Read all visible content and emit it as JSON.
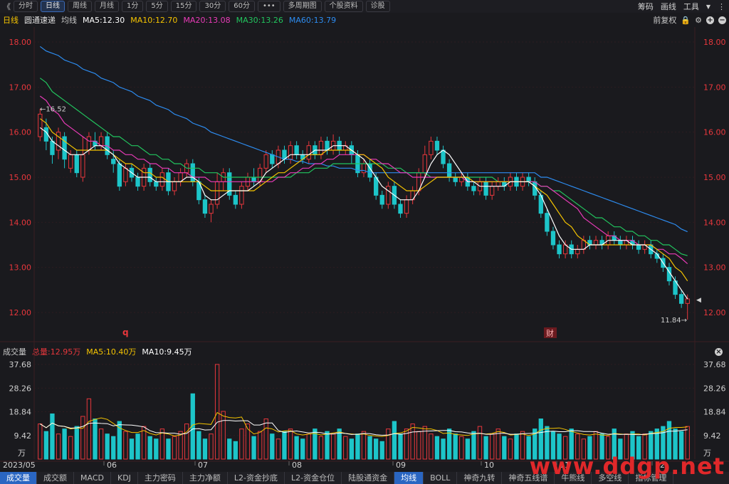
{
  "toolbar": {
    "back": "《",
    "tabs": [
      "分时",
      "日线",
      "周线",
      "月线",
      "1分",
      "5分",
      "15分",
      "30分",
      "60分",
      "•••",
      "多周期图",
      "个股资料",
      "诊股"
    ],
    "active_tab": "日线",
    "right": [
      "筹码",
      "画线",
      "工具"
    ]
  },
  "ma_bar": {
    "period": "日线",
    "name": "圆通速递",
    "label": "均线",
    "ma5": "MA5:12.30",
    "ma10": "MA10:12.70",
    "ma20": "MA20:13.08",
    "ma30": "MA30:13.26",
    "ma60": "MA60:13.79",
    "adjust": "前复权"
  },
  "colors": {
    "up": "#e8373c",
    "down": "#1dc5c9",
    "ma5": "#ffffff",
    "ma10": "#f5c400",
    "ma20": "#e93bb8",
    "ma30": "#22c55e",
    "ma60": "#2d8cf0",
    "axis_text": "#e8373c"
  },
  "price_axis": [
    "18.00",
    "17.00",
    "16.00",
    "15.00",
    "14.00",
    "13.00",
    "12.00"
  ],
  "price_annotations": {
    "high": "16.52",
    "low": "11.84"
  },
  "markers": {
    "q": "q",
    "cai": "财"
  },
  "volume_bar": {
    "title": "成交量",
    "total": "总量:12.95万",
    "ma5": "MA5:10.40万",
    "ma10": "MA10:9.45万"
  },
  "volume_axis": [
    "37.68",
    "28.26",
    "18.84",
    "9.42"
  ],
  "volume_unit": "万",
  "date_labels": [
    "2023/05",
    "06",
    "07",
    "08",
    "09",
    "10",
    "11",
    "12"
  ],
  "bottom_tabs": [
    "成交量",
    "成交额",
    "MACD",
    "KDJ",
    "主力密码",
    "主力净额",
    "L2-资金抄底",
    "L2-资金仓位",
    "陆股通资金",
    "均线",
    "BOLL",
    "神奇九转",
    "神奇五线谱",
    "牛熊线",
    "多空线",
    "指标管理"
  ],
  "active_bottom_tab": "成交量",
  "active_bottom_tab2": "均线",
  "watermark": "www.ddgp.net",
  "chart_data": {
    "type": "candlestick",
    "ylim": [
      11.6,
      18.2
    ],
    "candles": [
      [
        15.9,
        16.4,
        16.52,
        15.8
      ],
      [
        16.1,
        15.8,
        16.3,
        15.6
      ],
      [
        15.8,
        15.5,
        15.9,
        15.3
      ],
      [
        15.6,
        16.0,
        16.1,
        15.4
      ],
      [
        15.9,
        15.4,
        16.0,
        15.2
      ],
      [
        15.2,
        15.5,
        15.6,
        15.1
      ],
      [
        15.5,
        15.1,
        15.6,
        15.0
      ],
      [
        15.0,
        15.5,
        15.9,
        14.9
      ],
      [
        15.6,
        15.9,
        16.0,
        15.5
      ],
      [
        15.8,
        15.7,
        16.0,
        15.6
      ],
      [
        15.7,
        15.9,
        16.0,
        15.6
      ],
      [
        15.9,
        15.5,
        16.0,
        15.4
      ],
      [
        15.4,
        15.3,
        15.6,
        15.1
      ],
      [
        15.3,
        14.8,
        15.4,
        14.7
      ],
      [
        14.9,
        15.2,
        15.3,
        14.8
      ],
      [
        15.2,
        15.0,
        15.3,
        14.9
      ],
      [
        15.0,
        14.8,
        15.1,
        14.7
      ],
      [
        14.8,
        15.2,
        15.3,
        14.7
      ],
      [
        15.2,
        14.9,
        15.3,
        14.8
      ],
      [
        14.9,
        14.8,
        15.0,
        14.7
      ],
      [
        14.8,
        15.1,
        15.2,
        14.7
      ],
      [
        15.1,
        14.7,
        15.2,
        14.6
      ],
      [
        14.7,
        14.9,
        15.0,
        14.6
      ],
      [
        14.9,
        15.1,
        15.2,
        14.8
      ],
      [
        15.1,
        15.3,
        15.4,
        15.0
      ],
      [
        15.3,
        14.9,
        15.4,
        14.8
      ],
      [
        14.9,
        14.5,
        15.0,
        14.4
      ],
      [
        14.5,
        14.2,
        14.6,
        14.1
      ],
      [
        14.2,
        14.4,
        14.5,
        14.0
      ],
      [
        14.4,
        14.9,
        15.1,
        14.3
      ],
      [
        14.9,
        15.1,
        15.2,
        14.7
      ],
      [
        15.1,
        14.6,
        15.2,
        14.5
      ],
      [
        14.6,
        14.4,
        14.7,
        14.3
      ],
      [
        14.4,
        14.8,
        14.9,
        14.3
      ],
      [
        14.8,
        15.0,
        15.1,
        14.7
      ],
      [
        15.0,
        14.9,
        15.2,
        14.8
      ],
      [
        14.9,
        15.2,
        15.3,
        14.8
      ],
      [
        15.2,
        15.5,
        15.6,
        15.1
      ],
      [
        15.5,
        15.3,
        15.6,
        15.2
      ],
      [
        15.3,
        15.6,
        15.7,
        15.2
      ],
      [
        15.6,
        15.4,
        15.7,
        15.3
      ],
      [
        15.4,
        15.7,
        15.8,
        15.3
      ],
      [
        15.7,
        15.5,
        15.8,
        15.4
      ],
      [
        15.5,
        15.4,
        15.6,
        15.3
      ],
      [
        15.4,
        15.7,
        15.8,
        15.3
      ],
      [
        15.7,
        15.5,
        15.8,
        15.4
      ],
      [
        15.5,
        15.8,
        15.9,
        15.4
      ],
      [
        15.8,
        15.6,
        15.9,
        15.5
      ],
      [
        15.6,
        15.8,
        15.95,
        15.5
      ],
      [
        15.8,
        15.6,
        15.9,
        15.5
      ],
      [
        15.6,
        15.7,
        15.8,
        15.5
      ],
      [
        15.7,
        15.5,
        15.8,
        15.3
      ],
      [
        15.5,
        15.1,
        15.6,
        15.0
      ],
      [
        15.1,
        15.3,
        15.4,
        15.0
      ],
      [
        15.3,
        15.0,
        15.4,
        14.9
      ],
      [
        15.0,
        14.6,
        15.1,
        14.5
      ],
      [
        14.6,
        14.4,
        14.7,
        14.3
      ],
      [
        14.4,
        14.8,
        14.9,
        14.3
      ],
      [
        14.8,
        14.4,
        14.9,
        14.3
      ],
      [
        14.4,
        14.2,
        14.5,
        14.1
      ],
      [
        14.2,
        14.5,
        14.6,
        14.1
      ],
      [
        14.5,
        14.7,
        14.8,
        14.4
      ],
      [
        14.7,
        15.1,
        15.2,
        14.6
      ],
      [
        15.1,
        15.5,
        15.7,
        15.0
      ],
      [
        15.5,
        15.8,
        15.9,
        15.4
      ],
      [
        15.8,
        15.6,
        15.9,
        15.5
      ],
      [
        15.6,
        15.3,
        15.7,
        15.2
      ],
      [
        15.3,
        15.0,
        15.4,
        14.9
      ],
      [
        15.0,
        14.9,
        15.1,
        14.8
      ],
      [
        14.9,
        15.0,
        15.1,
        14.8
      ],
      [
        15.0,
        14.8,
        15.1,
        14.7
      ],
      [
        14.8,
        14.7,
        14.9,
        14.6
      ],
      [
        14.7,
        14.9,
        15.0,
        14.6
      ],
      [
        14.9,
        14.6,
        15.0,
        14.5
      ],
      [
        14.6,
        14.8,
        14.9,
        14.5
      ],
      [
        14.8,
        14.9,
        15.0,
        14.7
      ],
      [
        14.9,
        14.8,
        15.0,
        14.7
      ],
      [
        14.8,
        15.0,
        15.1,
        14.7
      ],
      [
        15.0,
        14.8,
        15.1,
        14.7
      ],
      [
        14.8,
        15.0,
        15.1,
        14.7
      ],
      [
        15.0,
        14.9,
        15.1,
        14.8
      ],
      [
        14.9,
        14.6,
        15.0,
        14.5
      ],
      [
        14.6,
        14.2,
        14.7,
        14.1
      ],
      [
        14.2,
        13.8,
        14.3,
        13.7
      ],
      [
        13.8,
        13.5,
        13.9,
        13.4
      ],
      [
        13.5,
        13.3,
        13.6,
        13.2
      ],
      [
        13.3,
        13.5,
        13.6,
        13.2
      ],
      [
        13.5,
        13.3,
        13.6,
        13.2
      ],
      [
        13.3,
        13.4,
        13.5,
        13.2
      ],
      [
        13.4,
        13.6,
        13.7,
        13.3
      ],
      [
        13.6,
        13.5,
        13.7,
        13.4
      ],
      [
        13.5,
        13.6,
        13.7,
        13.4
      ],
      [
        13.6,
        13.5,
        13.7,
        13.4
      ],
      [
        13.5,
        13.7,
        13.8,
        13.4
      ],
      [
        13.7,
        13.6,
        13.8,
        13.5
      ],
      [
        13.6,
        13.5,
        13.7,
        13.4
      ],
      [
        13.5,
        13.6,
        13.7,
        13.4
      ],
      [
        13.6,
        13.5,
        13.7,
        13.4
      ],
      [
        13.5,
        13.4,
        13.6,
        13.3
      ],
      [
        13.4,
        13.5,
        13.6,
        13.3
      ],
      [
        13.5,
        13.3,
        13.6,
        13.2
      ],
      [
        13.3,
        13.2,
        13.4,
        13.1
      ],
      [
        13.2,
        13.0,
        13.3,
        12.9
      ],
      [
        13.0,
        12.7,
        13.1,
        12.6
      ],
      [
        12.7,
        12.4,
        12.8,
        12.3
      ],
      [
        12.4,
        12.2,
        12.5,
        12.1
      ],
      [
        12.2,
        12.3,
        12.4,
        11.84
      ]
    ],
    "volume_ylim": [
      0,
      37.68
    ],
    "volumes": [
      14,
      11,
      18,
      10,
      12,
      9,
      13,
      17,
      24,
      16,
      12,
      10,
      9,
      15,
      11,
      8,
      10,
      13,
      9,
      8,
      12,
      8,
      9,
      11,
      14,
      26,
      11,
      8,
      10,
      37.68,
      19,
      8,
      7,
      12,
      14,
      9,
      11,
      16,
      10,
      8,
      11,
      12,
      9,
      8,
      10,
      12,
      9,
      11,
      10,
      12,
      9,
      8,
      10,
      11,
      9,
      8,
      7,
      12,
      15,
      10,
      12,
      14,
      11,
      13,
      10,
      9,
      8,
      12,
      10,
      9,
      8,
      11,
      13,
      9,
      10,
      12,
      9,
      8,
      10,
      11,
      9,
      12,
      16,
      13,
      11,
      10,
      9,
      12,
      10,
      8,
      9,
      11,
      10,
      9,
      12,
      8,
      10,
      11,
      9,
      10,
      11,
      12,
      13,
      15,
      12,
      11,
      13
    ],
    "ma5": [
      16.1,
      16.0,
      15.8,
      15.7,
      15.6,
      15.5,
      15.5,
      15.5,
      15.6,
      15.7,
      15.7,
      15.6,
      15.5,
      15.3,
      15.2,
      15.1,
      15.0,
      15.0,
      15.0,
      14.9,
      14.9,
      14.9,
      14.9,
      14.9,
      15.0,
      15.0,
      14.9,
      14.6,
      14.5,
      14.5,
      14.6,
      14.7,
      14.7,
      14.7,
      14.7,
      14.8,
      14.9,
      15.1,
      15.2,
      15.3,
      15.4,
      15.5,
      15.5,
      15.5,
      15.5,
      15.6,
      15.6,
      15.6,
      15.7,
      15.7,
      15.7,
      15.6,
      15.5,
      15.4,
      15.2,
      15.0,
      14.8,
      14.7,
      14.6,
      14.5,
      14.5,
      14.5,
      14.7,
      15.0,
      15.3,
      15.5,
      15.6,
      15.5,
      15.3,
      15.1,
      14.9,
      14.9,
      14.8,
      14.8,
      14.8,
      14.8,
      14.8,
      14.9,
      14.9,
      14.9,
      14.9,
      14.8,
      14.6,
      14.3,
      14.0,
      13.7,
      13.5,
      13.4,
      13.4,
      13.4,
      13.5,
      13.5,
      13.5,
      13.6,
      13.6,
      13.6,
      13.6,
      13.5,
      13.5,
      13.5,
      13.4,
      13.3,
      13.1,
      12.9,
      12.7,
      12.5,
      12.3
    ],
    "ma10": [
      16.3,
      16.2,
      16.0,
      15.9,
      15.8,
      15.7,
      15.6,
      15.6,
      15.6,
      15.6,
      15.6,
      15.6,
      15.5,
      15.4,
      15.3,
      15.3,
      15.2,
      15.1,
      15.1,
      15.0,
      15.0,
      14.9,
      14.9,
      14.9,
      14.9,
      14.9,
      14.9,
      14.8,
      14.7,
      14.7,
      14.7,
      14.7,
      14.7,
      14.7,
      14.7,
      14.7,
      14.8,
      14.9,
      15.0,
      15.1,
      15.1,
      15.2,
      15.3,
      15.4,
      15.5,
      15.5,
      15.5,
      15.6,
      15.6,
      15.6,
      15.6,
      15.6,
      15.5,
      15.5,
      15.4,
      15.3,
      15.2,
      15.0,
      14.9,
      14.8,
      14.7,
      14.7,
      14.7,
      14.8,
      14.9,
      15.0,
      15.0,
      15.0,
      15.0,
      15.0,
      15.0,
      14.9,
      14.9,
      14.9,
      14.9,
      14.9,
      14.9,
      14.9,
      14.9,
      14.9,
      14.9,
      14.8,
      14.7,
      14.6,
      14.4,
      14.2,
      14.0,
      13.9,
      13.7,
      13.6,
      13.5,
      13.5,
      13.5,
      13.5,
      13.5,
      13.5,
      13.5,
      13.5,
      13.5,
      13.5,
      13.5,
      13.4,
      13.3,
      13.2,
      13.0,
      12.9,
      12.7
    ],
    "ma20": [
      16.8,
      16.7,
      16.5,
      16.4,
      16.2,
      16.1,
      16.0,
      15.9,
      15.8,
      15.8,
      15.7,
      15.7,
      15.6,
      15.6,
      15.5,
      15.5,
      15.4,
      15.4,
      15.3,
      15.3,
      15.2,
      15.2,
      15.1,
      15.1,
      15.1,
      15.0,
      15.0,
      15.0,
      14.9,
      14.9,
      14.9,
      14.9,
      14.9,
      14.9,
      14.9,
      14.9,
      14.9,
      14.9,
      14.9,
      15.0,
      15.0,
      15.1,
      15.1,
      15.2,
      15.2,
      15.3,
      15.3,
      15.4,
      15.4,
      15.5,
      15.5,
      15.5,
      15.5,
      15.5,
      15.4,
      15.4,
      15.3,
      15.3,
      15.2,
      15.1,
      15.1,
      15.0,
      15.0,
      15.0,
      15.0,
      15.0,
      15.0,
      15.0,
      15.0,
      15.0,
      14.9,
      14.9,
      14.9,
      14.9,
      14.9,
      14.9,
      14.9,
      14.9,
      14.9,
      14.9,
      14.9,
      14.9,
      14.8,
      14.8,
      14.7,
      14.6,
      14.5,
      14.4,
      14.3,
      14.1,
      14.0,
      13.9,
      13.8,
      13.7,
      13.7,
      13.6,
      13.6,
      13.6,
      13.5,
      13.5,
      13.5,
      13.4,
      13.4,
      13.3,
      13.3,
      13.2,
      13.08
    ],
    "ma30": [
      17.2,
      17.1,
      16.9,
      16.8,
      16.7,
      16.6,
      16.5,
      16.4,
      16.3,
      16.2,
      16.1,
      16.0,
      15.9,
      15.9,
      15.8,
      15.7,
      15.7,
      15.6,
      15.5,
      15.5,
      15.4,
      15.4,
      15.3,
      15.3,
      15.2,
      15.2,
      15.2,
      15.1,
      15.1,
      15.1,
      15.0,
      15.0,
      15.0,
      15.0,
      15.0,
      15.0,
      15.0,
      15.0,
      15.0,
      15.0,
      15.0,
      15.0,
      15.1,
      15.1,
      15.1,
      15.2,
      15.2,
      15.2,
      15.3,
      15.3,
      15.3,
      15.3,
      15.3,
      15.3,
      15.3,
      15.3,
      15.3,
      15.2,
      15.2,
      15.2,
      15.1,
      15.1,
      15.1,
      15.1,
      15.0,
      15.0,
      15.0,
      15.0,
      15.0,
      15.0,
      15.0,
      15.0,
      15.0,
      15.0,
      15.0,
      14.9,
      14.9,
      14.9,
      14.9,
      14.9,
      14.9,
      14.9,
      14.8,
      14.8,
      14.7,
      14.7,
      14.6,
      14.5,
      14.4,
      14.3,
      14.2,
      14.1,
      14.1,
      14.0,
      13.9,
      13.9,
      13.8,
      13.8,
      13.7,
      13.7,
      13.6,
      13.6,
      13.5,
      13.5,
      13.4,
      13.3,
      13.26
    ],
    "ma60": [
      17.9,
      17.8,
      17.75,
      17.7,
      17.6,
      17.55,
      17.5,
      17.4,
      17.35,
      17.3,
      17.2,
      17.15,
      17.1,
      17.0,
      16.95,
      16.9,
      16.8,
      16.75,
      16.7,
      16.6,
      16.55,
      16.5,
      16.4,
      16.35,
      16.3,
      16.2,
      16.15,
      16.1,
      16.0,
      15.95,
      15.9,
      15.85,
      15.8,
      15.75,
      15.7,
      15.65,
      15.6,
      15.55,
      15.5,
      15.45,
      15.4,
      15.4,
      15.35,
      15.35,
      15.3,
      15.3,
      15.3,
      15.25,
      15.25,
      15.2,
      15.2,
      15.2,
      15.15,
      15.15,
      15.1,
      15.1,
      15.1,
      15.1,
      15.1,
      15.1,
      15.1,
      15.1,
      15.1,
      15.1,
      15.1,
      15.1,
      15.1,
      15.1,
      15.1,
      15.1,
      15.1,
      15.1,
      15.1,
      15.1,
      15.1,
      15.1,
      15.1,
      15.1,
      15.1,
      15.1,
      15.1,
      15.1,
      15.0,
      15.0,
      14.95,
      14.9,
      14.85,
      14.8,
      14.75,
      14.7,
      14.65,
      14.6,
      14.55,
      14.5,
      14.45,
      14.4,
      14.35,
      14.3,
      14.25,
      14.2,
      14.15,
      14.1,
      14.05,
      14.0,
      13.95,
      13.85,
      13.79
    ]
  }
}
